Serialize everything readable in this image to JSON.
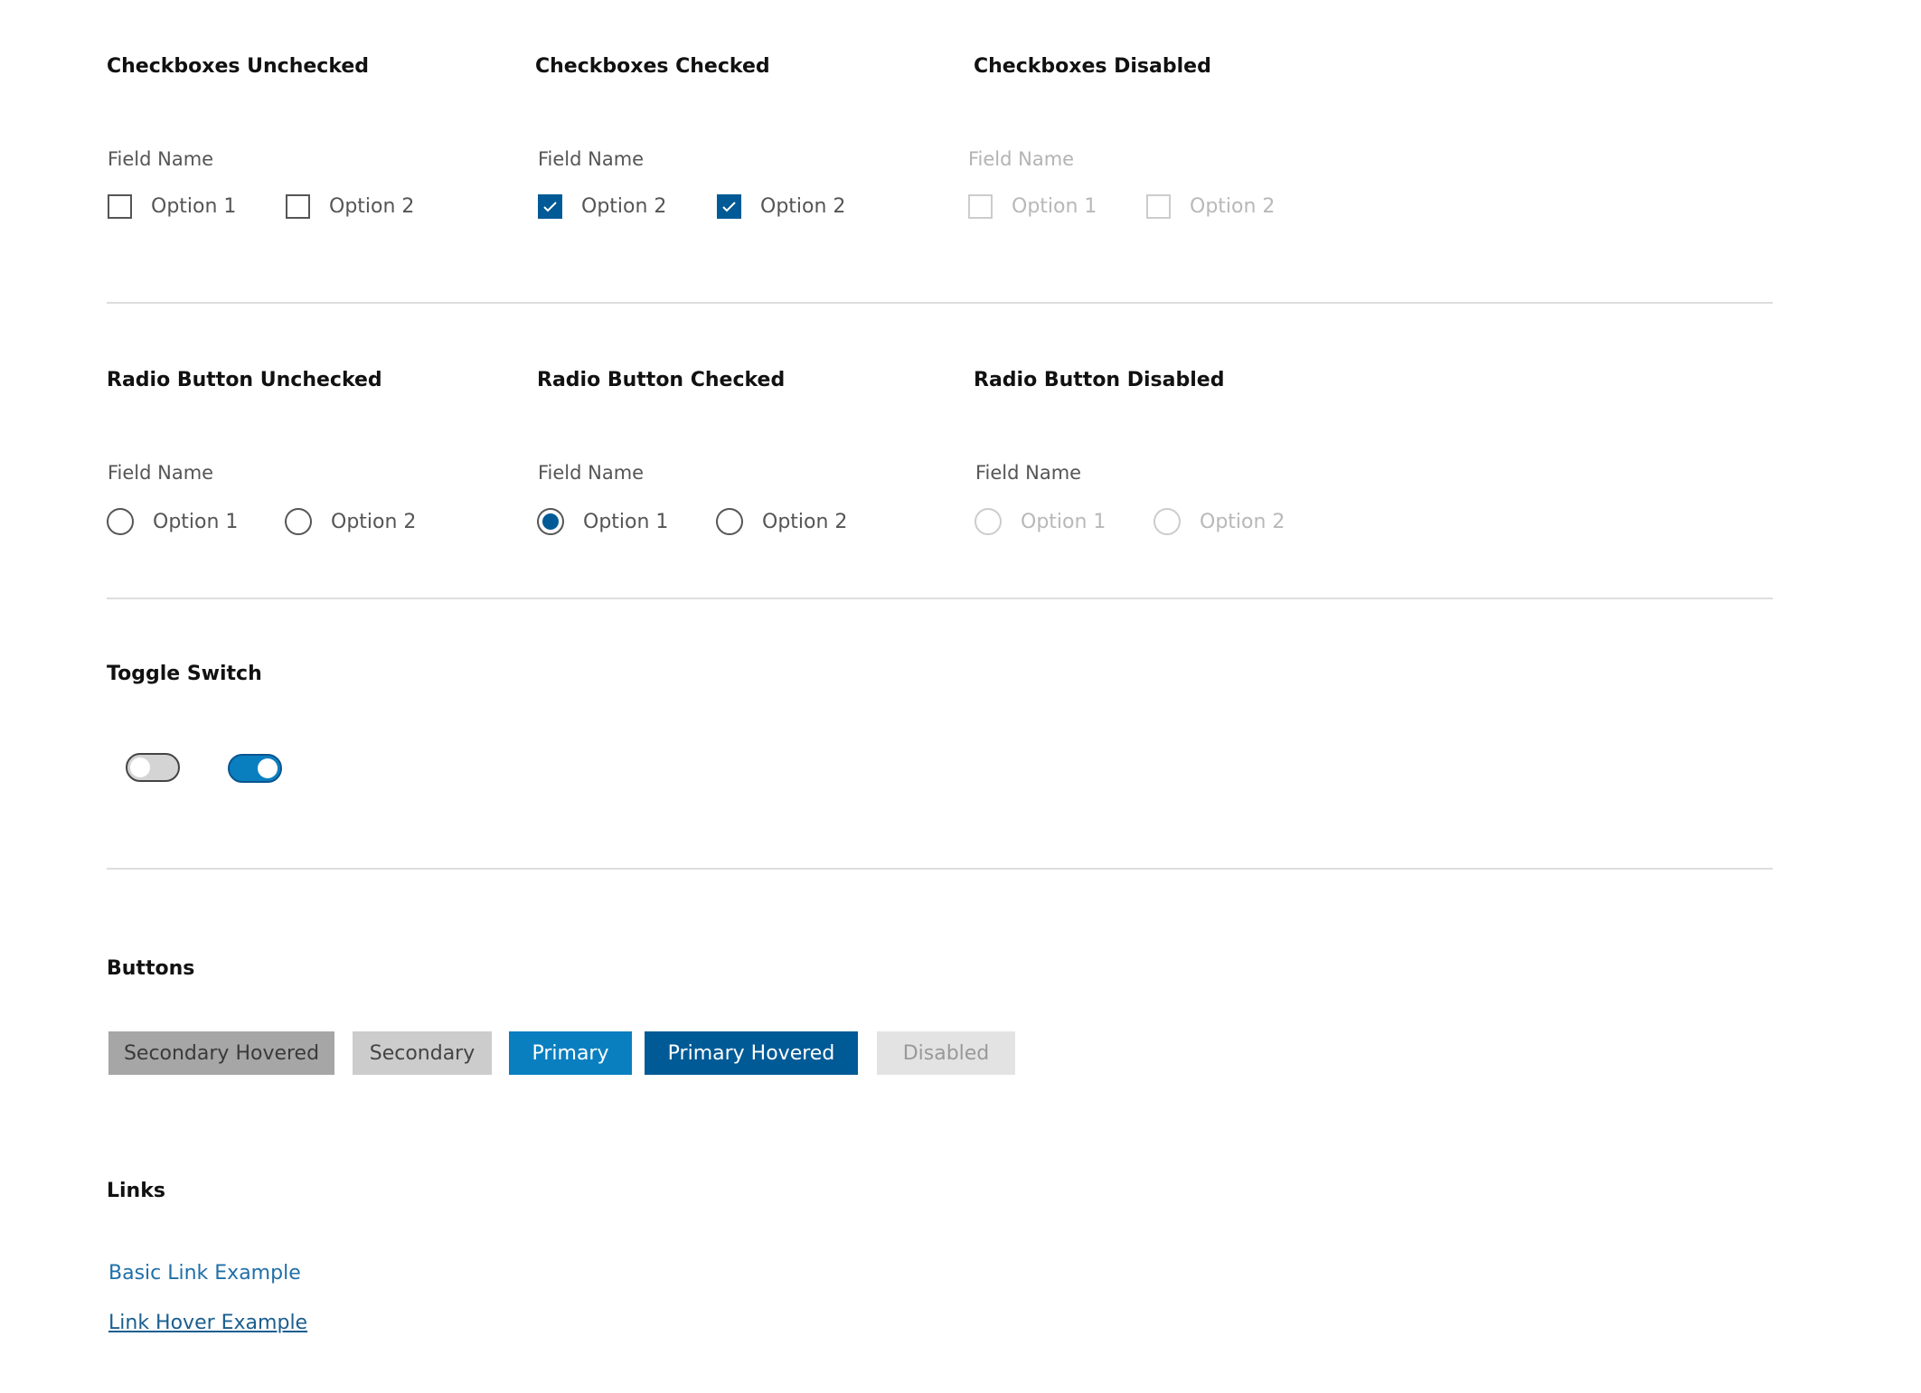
{
  "checkboxes": {
    "unchecked": {
      "title": "Checkboxes Unchecked",
      "field_label": "Field Name",
      "options": [
        "Option 1",
        "Option 2"
      ]
    },
    "checked": {
      "title": "Checkboxes Checked",
      "field_label": "Field Name",
      "options": [
        "Option 2",
        "Option 2"
      ]
    },
    "disabled": {
      "title": "Checkboxes Disabled",
      "field_label": "Field Name",
      "options": [
        "Option 1",
        "Option 2"
      ]
    }
  },
  "radios": {
    "unchecked": {
      "title": "Radio Button Unchecked",
      "field_label": "Field Name",
      "options": [
        "Option 1",
        "Option 2"
      ]
    },
    "checked": {
      "title": "Radio Button Checked",
      "field_label": "Field Name",
      "options": [
        "Option 1",
        "Option 2"
      ]
    },
    "disabled": {
      "title": "Radio Button Disabled",
      "field_label": "Field Name",
      "options": [
        "Option 1",
        "Option 2"
      ]
    }
  },
  "toggle": {
    "title": "Toggle Switch",
    "states": [
      "off",
      "on"
    ]
  },
  "buttons": {
    "title": "Buttons",
    "items": [
      "Secondary Hovered",
      "Secondary",
      "Primary",
      "Primary Hovered",
      "Disabled"
    ]
  },
  "links": {
    "title": "Links",
    "basic": "Basic Link Example",
    "hover": "Link Hover Example "
  },
  "colors": {
    "primary": "#0a7fc0",
    "primary_hovered": "#005a96",
    "secondary": "#cccccc",
    "secondary_hovered": "#a6a6a6",
    "disabled": "#e3e3e3",
    "link": "#1f6fa8"
  }
}
